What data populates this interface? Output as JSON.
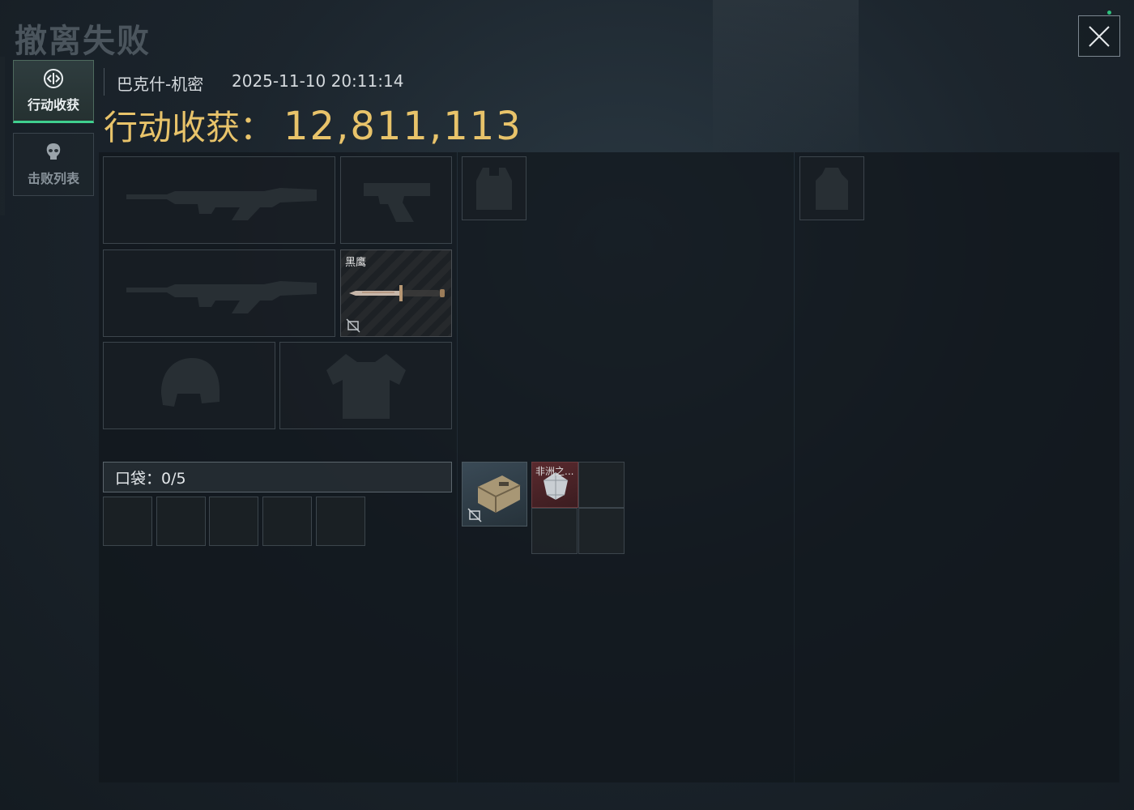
{
  "page": {
    "title": "撤离失败",
    "close_icon": "close-icon",
    "colors": {
      "accent_green": "#3fcf8e",
      "gold": "#e8c36a",
      "red_rarity": "#4a2226"
    }
  },
  "sidebar": {
    "tabs": [
      {
        "label": "行动收获",
        "icon": "loot-icon",
        "active": true
      },
      {
        "label": "击败列表",
        "icon": "skull-icon",
        "active": false
      }
    ]
  },
  "header": {
    "map": "巴克什-机密",
    "timestamp": "2025-11-10 20:11:14",
    "loot_label": "行动收获：",
    "loot_value": "12,811,113"
  },
  "equipment": {
    "primary_weapon_icon": "rifle-icon",
    "secondary_weapon_icon": "rifle-icon",
    "pistol_icon": "pistol-icon",
    "melee": {
      "name": "黑鹰",
      "icon": "knife-icon",
      "locked_icon": "no-trade-icon"
    },
    "helmet_icon": "helmet-icon",
    "armor_icon": "armor-icon"
  },
  "pocket": {
    "label": "口袋：0/5",
    "slots": 5
  },
  "chest_rig": {
    "slot_icon": "vest-icon",
    "items": [
      {
        "name": "",
        "icon": "case-icon",
        "locked_icon": "no-trade-icon"
      },
      {
        "name": "非洲之...",
        "icon": "diamond-icon"
      }
    ]
  },
  "backpack": {
    "slot_icon": "backpack-icon"
  }
}
